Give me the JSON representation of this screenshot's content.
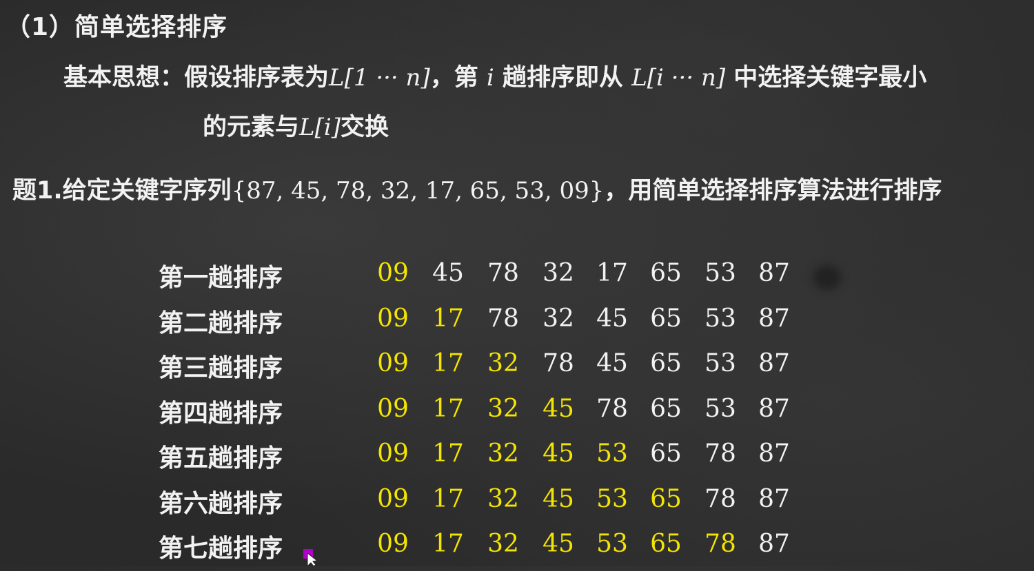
{
  "heading": "（1）简单选择排序",
  "idea": {
    "label": "基本思想：",
    "text_a": "假设排序表为",
    "range_a": "L[1 ··· n]",
    "text_b": "，第",
    "var_i": "i",
    "text_c": "趟排序即从",
    "range_b": "L[i ··· n]",
    "text_d": "中选择关键字最小",
    "line2_a": "的元素与",
    "elem": "L[i]",
    "line2_b": "交换"
  },
  "problem": {
    "label": "题1.给定关键字序列",
    "keys": "{87, 45, 78, 32, 17, 65, 53, 09}",
    "suffix": "，用简单选择排序算法进行排序"
  },
  "passes": [
    {
      "label": "第一趟排序",
      "values": [
        "09",
        "45",
        "78",
        "32",
        "17",
        "65",
        "53",
        "87"
      ],
      "sorted_count": 1
    },
    {
      "label": "第二趟排序",
      "values": [
        "09",
        "17",
        "78",
        "32",
        "45",
        "65",
        "53",
        "87"
      ],
      "sorted_count": 2
    },
    {
      "label": "第三趟排序",
      "values": [
        "09",
        "17",
        "32",
        "78",
        "45",
        "65",
        "53",
        "87"
      ],
      "sorted_count": 3
    },
    {
      "label": "第四趟排序",
      "values": [
        "09",
        "17",
        "32",
        "45",
        "78",
        "65",
        "53",
        "87"
      ],
      "sorted_count": 4
    },
    {
      "label": "第五趟排序",
      "values": [
        "09",
        "17",
        "32",
        "45",
        "53",
        "65",
        "78",
        "87"
      ],
      "sorted_count": 5
    },
    {
      "label": "第六趟排序",
      "values": [
        "09",
        "17",
        "32",
        "45",
        "53",
        "65",
        "78",
        "87"
      ],
      "sorted_count": 6
    },
    {
      "label": "第七趟排序",
      "values": [
        "09",
        "17",
        "32",
        "45",
        "53",
        "65",
        "78",
        "87"
      ],
      "sorted_count": 7
    }
  ],
  "colors": {
    "background": "#2a2a2a",
    "text": "#f2f2f2",
    "sorted_highlight": "#f4e500",
    "cursor": "#b000c8"
  },
  "icons": {
    "cursor": "mouse-pointer-icon"
  }
}
